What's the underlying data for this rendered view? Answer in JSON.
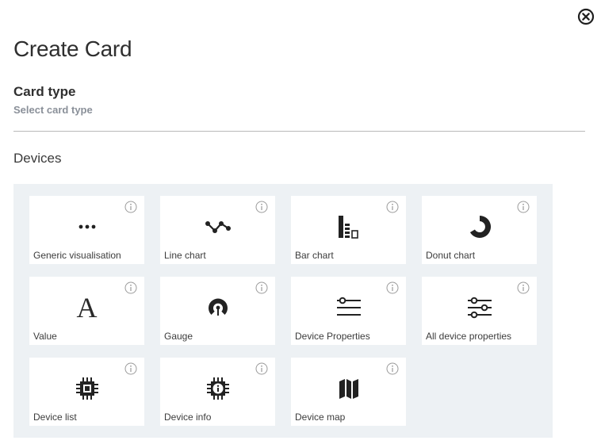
{
  "dialog": {
    "title": "Create Card",
    "close_icon": "close-circle-icon"
  },
  "card_type": {
    "label": "Card type",
    "hint": "Select card type"
  },
  "group": {
    "label": "Devices"
  },
  "cards": [
    {
      "label": "Generic visualisation",
      "icon": "dots-icon"
    },
    {
      "label": "Line chart",
      "icon": "line-chart-icon"
    },
    {
      "label": "Bar chart",
      "icon": "bar-chart-icon"
    },
    {
      "label": "Donut chart",
      "icon": "donut-chart-icon"
    },
    {
      "label": "Value",
      "icon": "value-icon"
    },
    {
      "label": "Gauge",
      "icon": "gauge-icon"
    },
    {
      "label": "Device Properties",
      "icon": "device-properties-icon"
    },
    {
      "label": "All device properties",
      "icon": "all-device-properties-icon"
    },
    {
      "label": "Device list",
      "icon": "chip-icon"
    },
    {
      "label": "Device info",
      "icon": "chip-info-icon"
    },
    {
      "label": "Device map",
      "icon": "map-icon"
    }
  ],
  "value_icon_glyph": "A"
}
